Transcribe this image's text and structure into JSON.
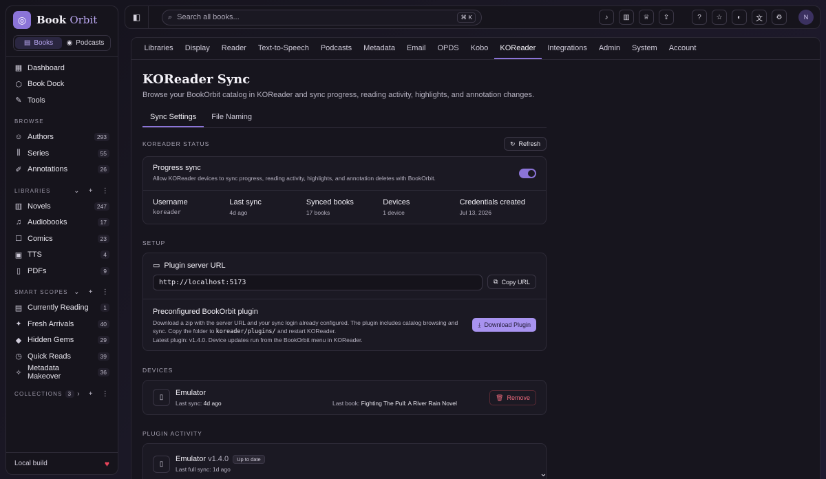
{
  "app": {
    "logo_word1": "Book",
    "logo_word2": "Orbit",
    "switch": [
      "Books",
      "Podcasts"
    ]
  },
  "sidebar": {
    "main": [
      {
        "label": "Dashboard",
        "icon": "dashboard-icon"
      },
      {
        "label": "Book Dock",
        "icon": "book-dock-icon"
      },
      {
        "label": "Tools",
        "icon": "wrench-icon"
      }
    ],
    "browse_title": "BROWSE",
    "browse": [
      {
        "label": "Authors",
        "count": "293"
      },
      {
        "label": "Series",
        "count": "55"
      },
      {
        "label": "Annotations",
        "count": "26"
      }
    ],
    "libraries_title": "LIBRARIES",
    "libraries": [
      {
        "label": "Novels",
        "count": "247"
      },
      {
        "label": "Audiobooks",
        "count": "17"
      },
      {
        "label": "Comics",
        "count": "23"
      },
      {
        "label": "TTS",
        "count": "4"
      },
      {
        "label": "PDFs",
        "count": "9"
      }
    ],
    "smart_title": "SMART SCOPES",
    "smart": [
      {
        "label": "Currently Reading",
        "count": "1"
      },
      {
        "label": "Fresh Arrivals",
        "count": "40"
      },
      {
        "label": "Hidden Gems",
        "count": "29"
      },
      {
        "label": "Quick Reads",
        "count": "39"
      },
      {
        "label": "Metadata Makeover",
        "count": "36"
      }
    ],
    "collections_title": "COLLECTIONS",
    "collections_count": "3",
    "footer": "Local build"
  },
  "topbar": {
    "search_placeholder": "Search all books...",
    "shortcut": "⌘ K",
    "avatar": "N"
  },
  "tabs": [
    "Libraries",
    "Display",
    "Reader",
    "Text-to-Speech",
    "Podcasts",
    "Metadata",
    "Email",
    "OPDS",
    "Kobo",
    "KOReader",
    "Integrations",
    "Admin",
    "System",
    "Account"
  ],
  "page": {
    "title": "KOReader Sync",
    "subtitle": "Browse your BookOrbit catalog in KOReader and sync progress, reading activity, highlights, and annotation changes.",
    "subtabs": [
      "Sync Settings",
      "File Naming"
    ]
  },
  "status": {
    "section": "KOREADER STATUS",
    "refresh": "Refresh",
    "progress_title": "Progress sync",
    "progress_desc": "Allow KOReader devices to sync progress, reading activity, highlights, and annotation deletes with BookOrbit.",
    "progress_enabled": true,
    "stats": [
      {
        "label": "Username",
        "value": "koreader"
      },
      {
        "label": "Last sync",
        "value": "4d ago"
      },
      {
        "label": "Synced books",
        "value": "17 books"
      },
      {
        "label": "Devices",
        "value": "1 device"
      },
      {
        "label": "Credentials created",
        "value": "Jul 13, 2026"
      }
    ]
  },
  "setup": {
    "section": "SETUP",
    "url_title": "Plugin server URL",
    "url_value": "http://localhost:5173",
    "copy_label": "Copy URL",
    "plugin_title": "Preconfigured BookOrbit plugin",
    "plugin_desc_1": "Download a zip with the server URL and your sync login already configured. The plugin includes catalog browsing and sync. Copy the folder to",
    "plugin_folder": "koreader/plugins/",
    "plugin_desc_2": "and restart KOReader.",
    "plugin_desc_3": "Latest plugin: v1.4.0. Device updates run from the BookOrbit menu in KOReader.",
    "download_label": "Download Plugin"
  },
  "devices": {
    "section": "DEVICES",
    "name": "Emulator",
    "last_sync_label": "Last sync:",
    "last_sync": "4d ago",
    "last_book_label": "Last book:",
    "last_book": "Fighting The Pull: A River Rain Novel",
    "remove": "Remove"
  },
  "activity": {
    "section": "PLUGIN ACTIVITY",
    "name": "Emulator",
    "version": "v1.4.0",
    "badge": "Up to date",
    "full_sync": "Last full sync: 1d ago"
  }
}
